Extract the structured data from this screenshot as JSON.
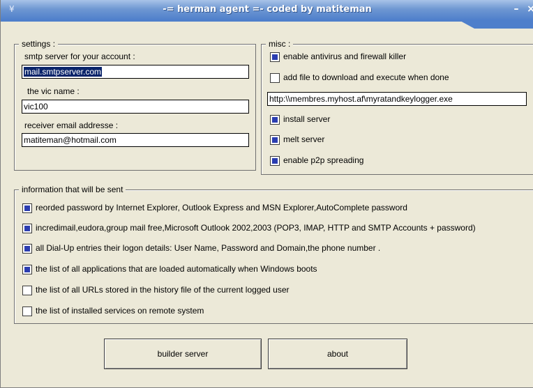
{
  "window": {
    "title": "-= herman agent =-   coded by matiteman",
    "icon": "app-icon",
    "controls": {
      "minimize": "–",
      "close": "×"
    }
  },
  "settings": {
    "legend": "settings :",
    "smtp_label": "smtp server for your account :",
    "smtp_value": "mail.smtpserver.com",
    "vic_label": "the vic name :",
    "vic_value": "vic100",
    "email_label": "receiver email addresse :",
    "email_value": "matiteman@hotmail.com"
  },
  "misc": {
    "legend": "misc  :",
    "options": [
      {
        "label": "enable antivirus and firewall killer",
        "checked": true
      },
      {
        "label": "add file to download and execute when done",
        "checked": false
      }
    ],
    "url_value": "http:\\\\membres.myhost.af\\myratandkeylogger.exe",
    "options2": [
      {
        "label": "install server",
        "checked": true
      },
      {
        "label": "melt server",
        "checked": true
      },
      {
        "label": "enable p2p spreading",
        "checked": true
      }
    ]
  },
  "info": {
    "legend": "information that will be sent",
    "items": [
      {
        "label": "reorded password by Internet Explorer, Outlook Express and MSN Explorer,AutoComplete password",
        "checked": true
      },
      {
        "label": "incredimail,eudora,group mail free,Microsoft Outlook 2002,2003 (POP3, IMAP, HTTP and SMTP Accounts + password)",
        "checked": true
      },
      {
        "label": "all Dial-Up entries their logon details: User Name, Password and Domain,the phone number .",
        "checked": true
      },
      {
        "label": "the list of all applications that are loaded automatically when Windows boots",
        "checked": true
      },
      {
        "label": " the list of all URLs stored in the history file of the current logged user",
        "checked": false
      },
      {
        "label": "the list of installed services on remote system",
        "checked": false
      }
    ]
  },
  "buttons": {
    "builder": "builder server",
    "about": "about"
  }
}
